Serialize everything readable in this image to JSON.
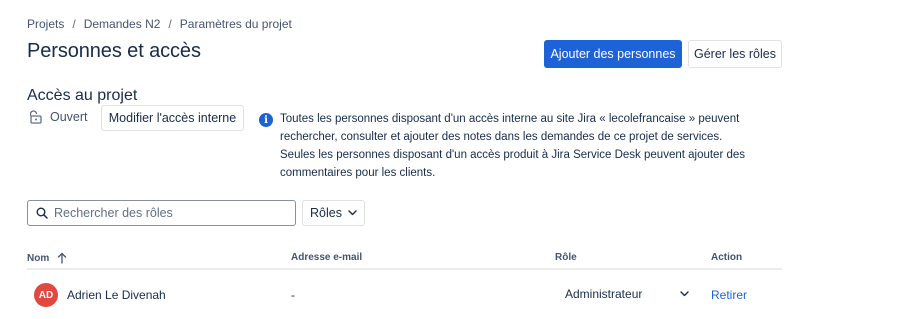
{
  "breadcrumb": {
    "items": [
      "Projets",
      "Demandes N2",
      "Paramètres du projet"
    ],
    "separator": "/"
  },
  "page": {
    "title": "Personnes et accès"
  },
  "header_actions": {
    "add_people_label": "Ajouter des personnes",
    "manage_roles_label": "Gérer les rôles"
  },
  "project_access": {
    "title": "Accès au projet",
    "status_icon": "unlock-icon",
    "status_label": "Ouvert",
    "modify_button_label": "Modifier l'accès interne",
    "info_icon": "info-icon",
    "info_text": "Toutes les personnes disposant d'un accès interne au site Jira « lecolefrancaise » peuvent rechercher, consulter et ajouter des notes dans les demandes de ce projet de services. Seules les personnes disposant d'un accès produit à Jira Service Desk peuvent ajouter des commentaires pour les clients."
  },
  "filters": {
    "search_placeholder": "Rechercher des rôles",
    "search_value": "",
    "roles_filter_label": "Rôles"
  },
  "table": {
    "columns": {
      "name": "Nom",
      "email": "Adresse e-mail",
      "role": "Rôle",
      "action": "Action"
    },
    "sort": "ascending",
    "rows": [
      {
        "avatar_initials": "AD",
        "name": "Adrien Le Divenah",
        "email": "-",
        "role": "Administrateur",
        "action": "Retirer"
      }
    ]
  },
  "colors": {
    "primary": "#1D63D7",
    "text": "#172B4D",
    "subtle_text": "#44546F",
    "avatar": "#E2483D",
    "border": "#DFE1E6"
  }
}
